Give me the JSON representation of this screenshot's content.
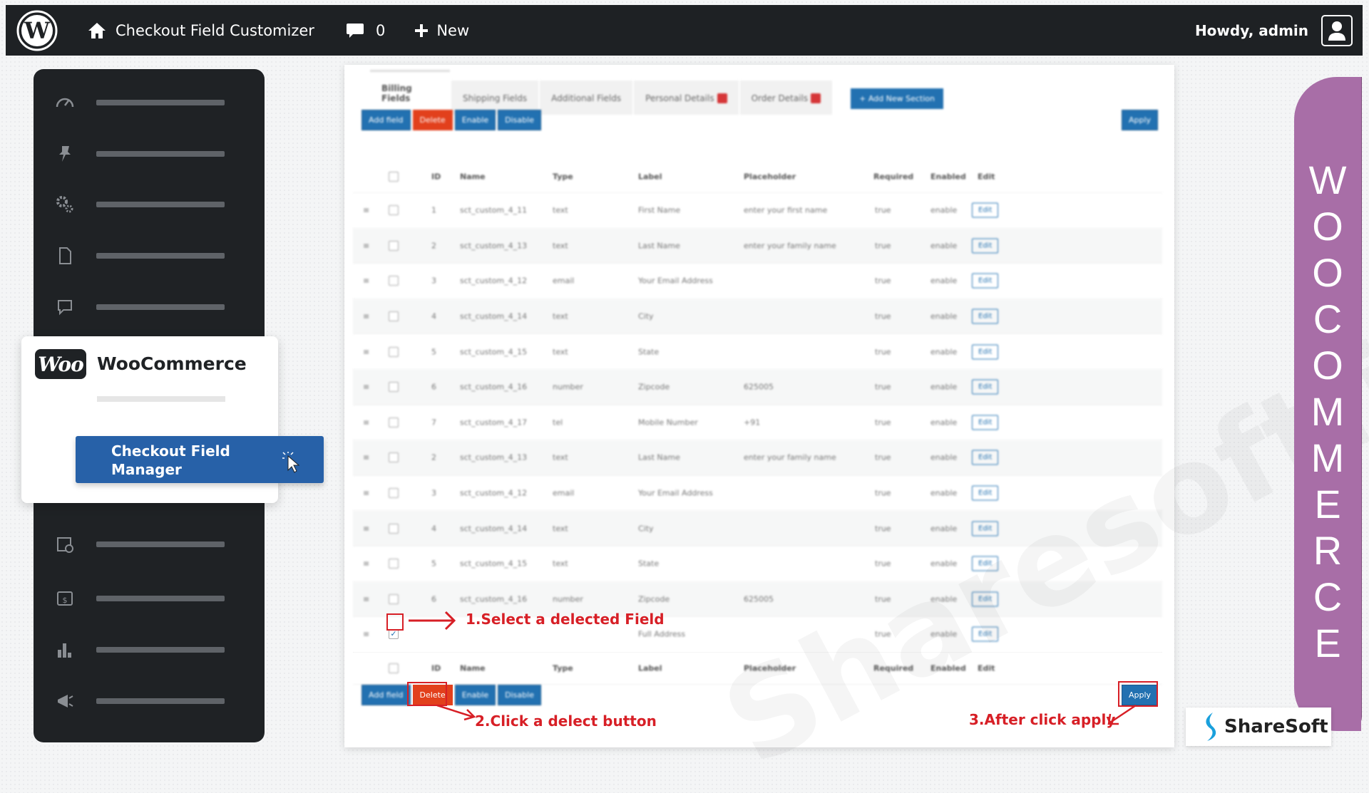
{
  "adminbar": {
    "site_name": "Checkout Field Customizer",
    "comment_count": "0",
    "new_label": "New",
    "howdy": "Howdy, admin"
  },
  "sidebar": {
    "woo_badge": "Woo",
    "woo_title": "WooCommerce",
    "submenu_active": "Checkout Field Manager",
    "icons": [
      "dashboard-icon",
      "pin-icon",
      "gears-icon",
      "page-icon",
      "comment-icon",
      "woo-orders-icon",
      "payments-icon",
      "analytics-icon",
      "marketing-icon"
    ]
  },
  "tabs": [
    {
      "label": "Billing Fields",
      "active": true
    },
    {
      "label": "Shipping Fields"
    },
    {
      "label": "Additional Fields"
    },
    {
      "label": "Personal Details",
      "badge": true
    },
    {
      "label": "Order Details",
      "badge": true
    }
  ],
  "add_section_label": "+ Add New Section",
  "actions": {
    "add_field": "Add field",
    "delete": "Delete",
    "enable": "Enable",
    "disable": "Disable",
    "apply": "Apply"
  },
  "table": {
    "headers": [
      "ID",
      "Name",
      "Type",
      "Label",
      "Placeholder",
      "Required",
      "Enabled",
      "Edit"
    ],
    "rows": [
      {
        "id": "1",
        "name": "sct_custom_4_11",
        "type": "text",
        "label": "First Name",
        "placeholder": "enter your first name",
        "required": "true",
        "enabled": "enable"
      },
      {
        "id": "2",
        "name": "sct_custom_4_13",
        "type": "text",
        "label": "Last Name",
        "placeholder": "enter your family name",
        "required": "true",
        "enabled": "enable"
      },
      {
        "id": "3",
        "name": "sct_custom_4_12",
        "type": "email",
        "label": "Your Email Address",
        "placeholder": "",
        "required": "true",
        "enabled": "enable"
      },
      {
        "id": "4",
        "name": "sct_custom_4_14",
        "type": "text",
        "label": "City",
        "placeholder": "",
        "required": "true",
        "enabled": "enable"
      },
      {
        "id": "5",
        "name": "sct_custom_4_15",
        "type": "text",
        "label": "State",
        "placeholder": "",
        "required": "true",
        "enabled": "enable"
      },
      {
        "id": "6",
        "name": "sct_custom_4_16",
        "type": "number",
        "label": "Zipcode",
        "placeholder": "625005",
        "required": "true",
        "enabled": "enable"
      },
      {
        "id": "7",
        "name": "sct_custom_4_17",
        "type": "tel",
        "label": "Mobile Number",
        "placeholder": "+91",
        "required": "true",
        "enabled": "enable"
      },
      {
        "id": "2",
        "name": "sct_custom_4_13",
        "type": "text",
        "label": "Last Name",
        "placeholder": "enter your family name",
        "required": "true",
        "enabled": "enable"
      },
      {
        "id": "3",
        "name": "sct_custom_4_12",
        "type": "email",
        "label": "Your Email Address",
        "placeholder": "",
        "required": "true",
        "enabled": "enable"
      },
      {
        "id": "4",
        "name": "sct_custom_4_14",
        "type": "text",
        "label": "City",
        "placeholder": "",
        "required": "true",
        "enabled": "enable"
      },
      {
        "id": "5",
        "name": "sct_custom_4_15",
        "type": "text",
        "label": "State",
        "placeholder": "",
        "required": "true",
        "enabled": "enable"
      },
      {
        "id": "6",
        "name": "sct_custom_4_16",
        "type": "number",
        "label": "Zipcode",
        "placeholder": "625005",
        "required": "true",
        "enabled": "enable"
      },
      {
        "id": "",
        "name": "",
        "type": "",
        "label": "Full Address",
        "placeholder": "",
        "required": "true",
        "enabled": "enable",
        "checked": true
      }
    ],
    "edit_label": "Edit"
  },
  "annotations": {
    "step1": "1.Select a delected Field",
    "step2": "2.Click a delect button",
    "step3": "3.After click apply"
  },
  "watermark": "Sharesoft.in",
  "banner_letters": [
    "W",
    "O",
    "O",
    "C",
    "O",
    "M",
    "M",
    "E",
    "R",
    "C",
    "E"
  ],
  "brand": "ShareSoft",
  "colors": {
    "accent": "#2271b1",
    "delete": "#e2401c",
    "annotation": "#d71f26",
    "banner": "#a86ea7",
    "dark": "#1e2124"
  }
}
